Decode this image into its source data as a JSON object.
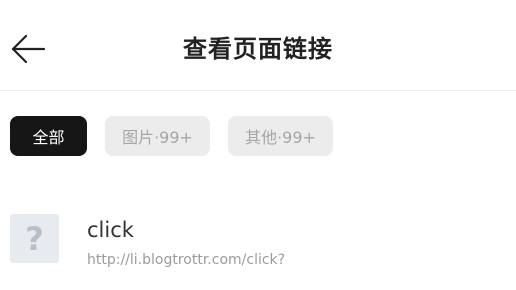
{
  "header": {
    "title": "查看页面链接",
    "back_icon": "arrow-left-icon"
  },
  "filters": [
    {
      "label": "全部",
      "active": true
    },
    {
      "label": "图片·99+",
      "active": false
    },
    {
      "label": "其他·99+",
      "active": false
    }
  ],
  "links": [
    {
      "thumbnail_glyph": "?",
      "title": "click",
      "url": "http://li.blogtrottr.com/click?"
    }
  ],
  "colors": {
    "active_chip_bg": "#161616",
    "inactive_chip_bg": "#ececec",
    "inactive_chip_text": "#a6a6a6",
    "thumb_bg": "#e7ebef"
  }
}
